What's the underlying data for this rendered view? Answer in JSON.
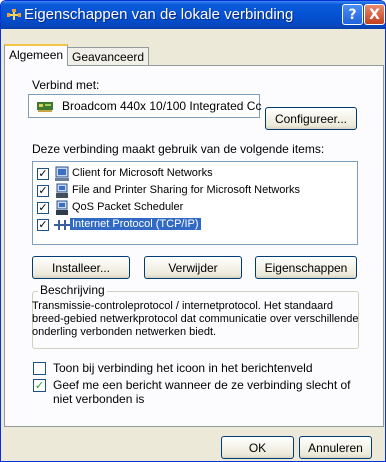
{
  "window": {
    "title": "Eigenschappen van de lokale verbinding",
    "help_label": "?",
    "close_label": "X"
  },
  "tabs": [
    {
      "label": "Algemeen",
      "active": true
    },
    {
      "label": "Geavanceerd",
      "active": false
    }
  ],
  "general": {
    "connect_using_label": "Verbind met:",
    "adapter_name": "Broadcom 440x 10/100 Integrated Cc",
    "configure_button": "Configureer...",
    "items_label": "Deze verbinding maakt gebruik van de volgende items:",
    "items": [
      {
        "label": "Client for Microsoft Networks",
        "checked": true,
        "icon": "network-client-icon",
        "selected": false
      },
      {
        "label": "File and Printer Sharing for Microsoft Networks",
        "checked": true,
        "icon": "file-printer-sharing-icon",
        "selected": false
      },
      {
        "label": "QoS Packet Scheduler",
        "checked": true,
        "icon": "qos-scheduler-icon",
        "selected": false
      },
      {
        "label": "Internet Protocol (TCP/IP)",
        "checked": true,
        "icon": "tcpip-protocol-icon",
        "selected": true
      }
    ],
    "install_button": "Installeer...",
    "remove_button": "Verwijder",
    "properties_button": "Eigenschappen",
    "description_title": "Beschrijving",
    "description_lines": [
      "Transmissie-controleprotocol / internetprotocol. Het standaard",
      "breed-gebied netwerkprotocol dat communicatie over verschillende",
      "onderling verbonden netwerken biedt."
    ],
    "show_icon_label": "Toon bij verbinding het icoon in het berichtenveld",
    "show_icon_checked": false,
    "notify_lines": [
      "Geef me een bericht wanneer de ze verbinding slecht of",
      "niet verbonden is"
    ],
    "notify_checked": true
  },
  "footer": {
    "ok_button": "OK",
    "cancel_button": "Annuleren"
  },
  "colors": {
    "titlebar": "#0552d4",
    "selection": "#316ac5",
    "check_green": "#21a121"
  }
}
